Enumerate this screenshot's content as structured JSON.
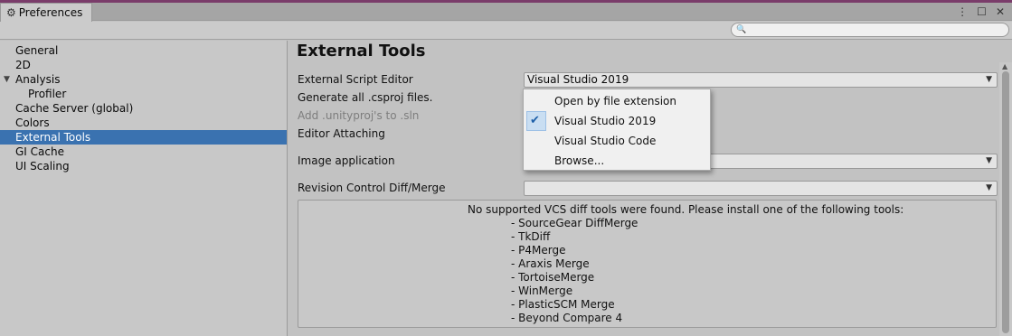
{
  "window": {
    "tab_title": "Preferences",
    "tab_icon": "gear-icon",
    "icons": [
      "kebab-menu-icon",
      "maximize-icon",
      "close-icon"
    ]
  },
  "search": {
    "placeholder": "",
    "value": ""
  },
  "sidebar": {
    "items": [
      {
        "label": "General"
      },
      {
        "label": "2D"
      },
      {
        "label": "Analysis"
      },
      {
        "label": "Profiler"
      },
      {
        "label": "Cache Server (global)"
      },
      {
        "label": "Colors"
      },
      {
        "label": "External Tools"
      },
      {
        "label": "GI Cache"
      },
      {
        "label": "UI Scaling"
      }
    ],
    "selected": "External Tools"
  },
  "main": {
    "heading": "External Tools",
    "external_script_editor": {
      "label": "External Script Editor",
      "value": "Visual Studio 2019"
    },
    "generate_csproj": {
      "label": "Generate all .csproj files."
    },
    "add_unityproj": {
      "label": "Add .unityproj's to .sln"
    },
    "editor_attaching": {
      "label": "Editor Attaching"
    },
    "image_application": {
      "label": "Image application",
      "value": ""
    },
    "revision_control": {
      "label": "Revision Control Diff/Merge",
      "value": ""
    },
    "help": {
      "title": "No supported VCS diff tools were found. Please install one of the following tools:",
      "tools": [
        "- SourceGear DiffMerge",
        "- TkDiff",
        "- P4Merge",
        "- Araxis Merge",
        "- TortoiseMerge",
        "- WinMerge",
        "- PlasticSCM Merge",
        "- Beyond Compare 4"
      ]
    }
  },
  "popup": {
    "items": [
      {
        "label": "Open by file extension",
        "checked": false
      },
      {
        "label": "Visual Studio 2019",
        "checked": true
      },
      {
        "label": "Visual Studio Code",
        "checked": false
      },
      {
        "label": "Browse...",
        "checked": false
      }
    ]
  },
  "colors": {
    "selection": "#3a72b0",
    "accent_strip": "#7a3c6a",
    "check": "#1d5fa8"
  }
}
